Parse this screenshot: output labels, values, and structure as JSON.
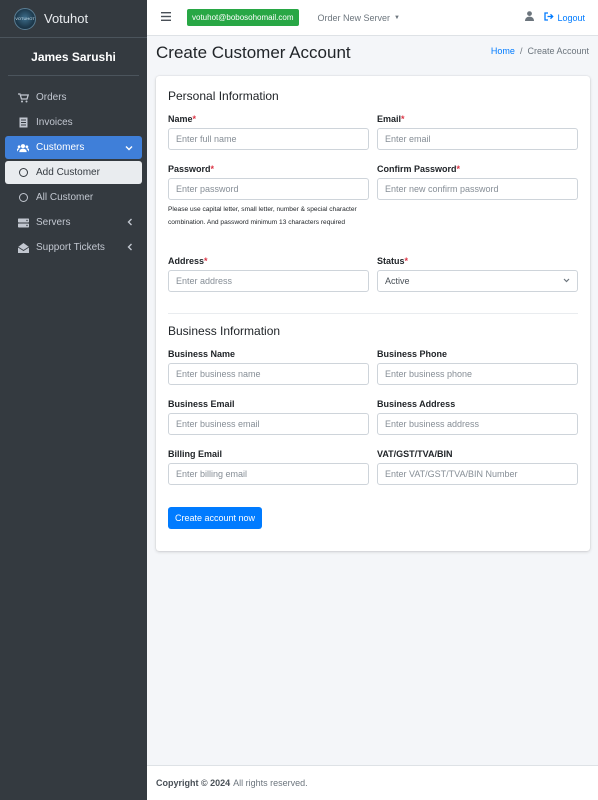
{
  "sidebar": {
    "brand": "Votuhot",
    "logo_text": "VOTUHOT",
    "user_name": "James Sarushi",
    "items": [
      {
        "label": "Orders",
        "icon": "cart-icon"
      },
      {
        "label": "Invoices",
        "icon": "file-icon"
      },
      {
        "label": "Customers",
        "icon": "users-icon"
      },
      {
        "label": "Add Customer",
        "icon": "circle-icon"
      },
      {
        "label": "All Customer",
        "icon": "circle-icon"
      },
      {
        "label": "Servers",
        "icon": "server-icon"
      },
      {
        "label": "Support Tickets",
        "icon": "envelope-open-icon"
      }
    ]
  },
  "topbar": {
    "email": "votuhot@bobosohomail.com",
    "order_menu": "Order New Server",
    "logout": "Logout"
  },
  "header": {
    "title": "Create Customer Account",
    "breadcrumb_home": "Home",
    "breadcrumb_sep": "/",
    "breadcrumb_current": "Create Account"
  },
  "form": {
    "personal_title": "Personal Information",
    "name_label": "Name",
    "name_placeholder": "Enter full name",
    "email_label": "Email",
    "email_placeholder": "Enter email",
    "password_label": "Password",
    "password_placeholder": "Enter password",
    "password_hint": "Please use capital letter, small letter, number & special character combination. And password minimum 13 characters required",
    "confirm_label": "Confirm Password",
    "confirm_placeholder": "Enter new confirm password",
    "address_label": "Address",
    "address_placeholder": "Enter address",
    "status_label": "Status",
    "status_value": "Active",
    "required_mark": "*",
    "business_title": "Business Information",
    "biz_name_label": "Business Name",
    "biz_name_placeholder": "Enter business name",
    "biz_phone_label": "Business Phone",
    "biz_phone_placeholder": "Enter business phone",
    "biz_email_label": "Business Email",
    "biz_email_placeholder": "Enter business email",
    "biz_address_label": "Business Address",
    "biz_address_placeholder": "Enter business address",
    "billing_label": "Billing Email",
    "billing_placeholder": "Enter billing email",
    "vat_label": "VAT/GST/TVA/BIN",
    "vat_placeholder": "Enter VAT/GST/TVA/BIN Number",
    "submit": "Create account now"
  },
  "footer": {
    "copyright": "Copyright © 2024",
    "rest": "All rights reserved."
  },
  "colors": {
    "sidebar_bg": "#343a40",
    "active_blue": "#3f7fd9",
    "primary": "#007bff",
    "success": "#28a745",
    "required": "#dc3545"
  }
}
